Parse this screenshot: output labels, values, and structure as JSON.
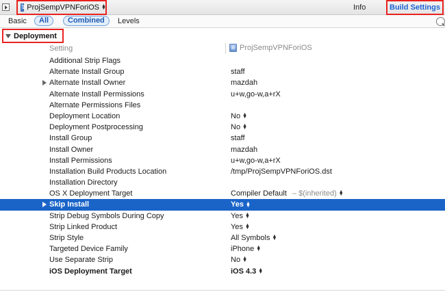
{
  "toolbar": {
    "target_name": "ProjSempVPNForiOS",
    "tab_info": "Info",
    "tab_build_settings": "Build Settings"
  },
  "filter": {
    "basic": "Basic",
    "all": "All",
    "combined": "Combined",
    "levels": "Levels"
  },
  "section": {
    "title": "Deployment"
  },
  "columns": {
    "setting": "Setting",
    "target": "ProjSempVPNForiOS"
  },
  "rows": [
    {
      "name": "Additional Strip Flags",
      "value": ""
    },
    {
      "name": "Alternate Install Group",
      "value": "staff"
    },
    {
      "name": "Alternate Install Owner",
      "value": "mazdah",
      "expandable": true
    },
    {
      "name": "Alternate Install Permissions",
      "value": "u+w,go-w,a+rX"
    },
    {
      "name": "Alternate Permissions Files",
      "value": ""
    },
    {
      "name": "Deployment Location",
      "value": "No",
      "popup": true
    },
    {
      "name": "Deployment Postprocessing",
      "value": "No",
      "popup": true
    },
    {
      "name": "Install Group",
      "value": "staff"
    },
    {
      "name": "Install Owner",
      "value": "mazdah"
    },
    {
      "name": "Install Permissions",
      "value": "u+w,go-w,a+rX"
    },
    {
      "name": "Installation Build Products Location",
      "value": "/tmp/ProjSempVPNForiOS.dst"
    },
    {
      "name": "Installation Directory",
      "value": ""
    },
    {
      "name": "OS X Deployment Target",
      "value": "Compiler Default",
      "inherited": "–  $(inherited)",
      "popup": true
    },
    {
      "name": "Skip Install",
      "value": "Yes",
      "popup": true,
      "expandable": true,
      "selected": true
    },
    {
      "name": "Strip Debug Symbols During Copy",
      "value": "Yes",
      "popup": true
    },
    {
      "name": "Strip Linked Product",
      "value": "Yes",
      "popup": true
    },
    {
      "name": "Strip Style",
      "value": "All Symbols",
      "popup": true
    },
    {
      "name": "Targeted Device Family",
      "value": "iPhone",
      "popup": true
    },
    {
      "name": "Use Separate Strip",
      "value": "No",
      "popup": true
    },
    {
      "name": "iOS Deployment Target",
      "value": "iOS 4.3",
      "popup": true,
      "bold": true
    }
  ],
  "colors": {
    "selection": "#1a64c8",
    "highlight_box": "#e8221f",
    "accent_text": "#1b63d3"
  },
  "icons": {
    "panel_toggle": "sidebar-toggle-icon",
    "target": "target-icon",
    "search": "search-icon",
    "popup": "up-down-arrows-icon"
  }
}
